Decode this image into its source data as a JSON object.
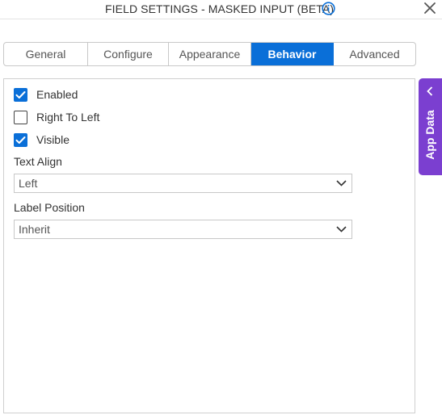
{
  "header": {
    "title": "FIELD SETTINGS - MASKED INPUT (BETA)",
    "info_icon": "info-circle-icon",
    "close_icon": "close-icon"
  },
  "tabs": [
    {
      "label": "General",
      "active": false
    },
    {
      "label": "Configure",
      "active": false
    },
    {
      "label": "Appearance",
      "active": false
    },
    {
      "label": "Behavior",
      "active": true
    },
    {
      "label": "Advanced",
      "active": false
    }
  ],
  "behavior": {
    "enabled": {
      "label": "Enabled",
      "checked": true
    },
    "right_to_left": {
      "label": "Right To Left",
      "checked": false
    },
    "visible": {
      "label": "Visible",
      "checked": true
    },
    "text_align": {
      "label": "Text Align",
      "value": "Left"
    },
    "label_position": {
      "label": "Label Position",
      "value": "Inherit"
    }
  },
  "app_data": {
    "label": "App Data"
  },
  "colors": {
    "accent": "#0a6fd8",
    "app_data_bg": "#7b3fd0"
  }
}
